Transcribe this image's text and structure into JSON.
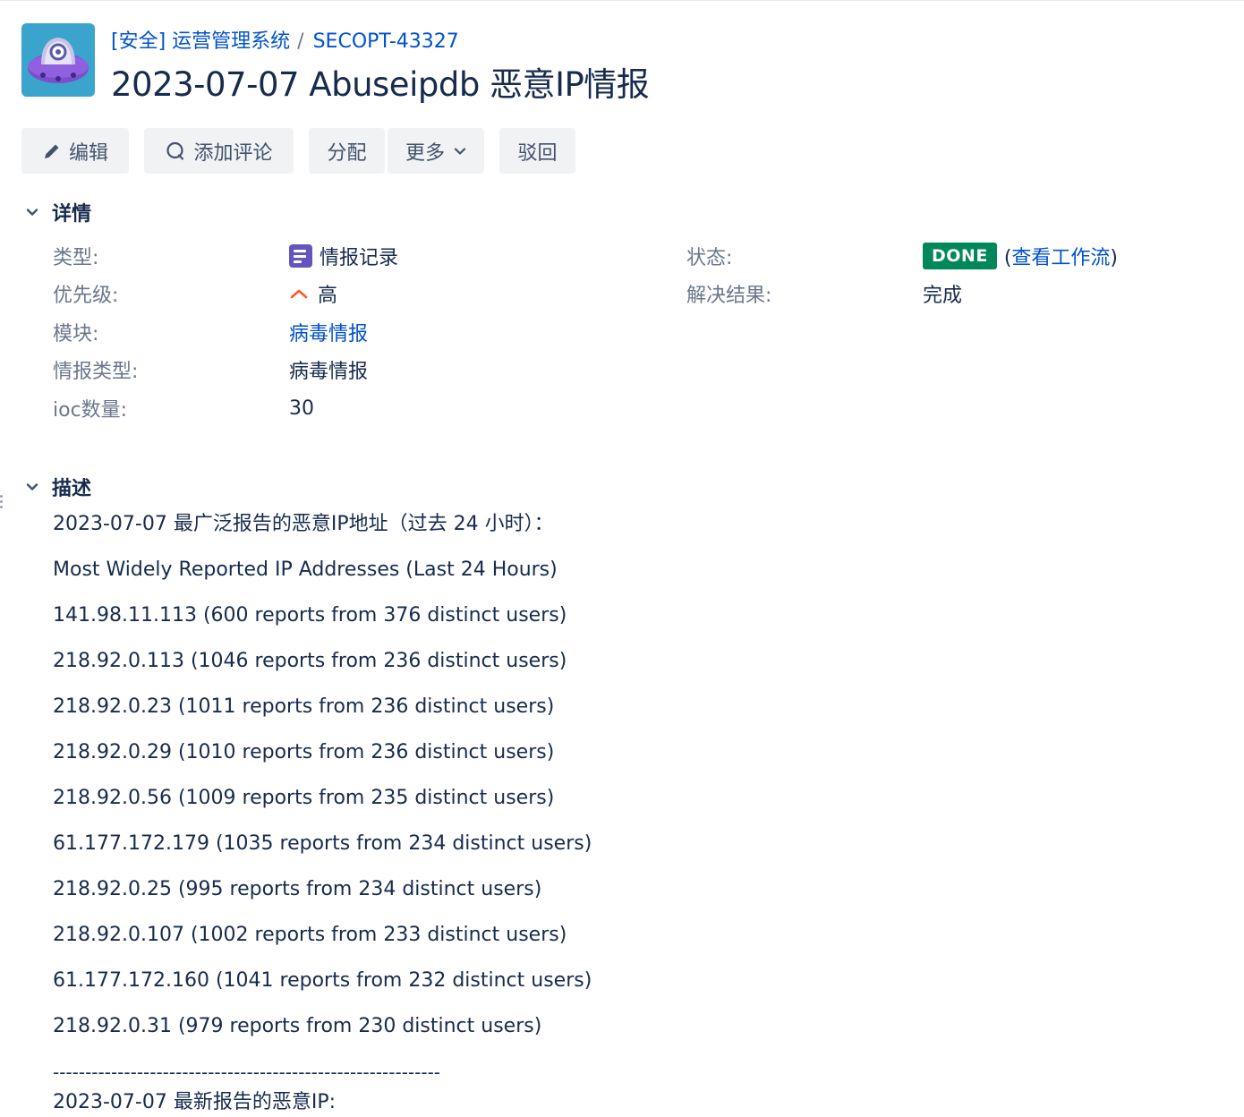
{
  "header": {
    "breadcrumb_project": "[安全] 运营管理系统",
    "breadcrumb_sep": "/",
    "breadcrumb_issue": "SECOPT-43327",
    "title": "2023-07-07 Abuseipdb 恶意IP情报",
    "avatar_icon": "ufo-project-avatar-icon"
  },
  "toolbar": {
    "edit": "编辑",
    "comment": "添加评论",
    "assign": "分配",
    "more": "更多",
    "reject": "驳回"
  },
  "details": {
    "section_title": "详情",
    "type_label": "类型:",
    "type_value": "情报记录",
    "priority_label": "优先级:",
    "priority_value": "高",
    "module_label": "模块:",
    "module_value": "病毒情报",
    "intel_type_label": "情报类型:",
    "intel_type_value": "病毒情报",
    "ioc_label": "ioc数量:",
    "ioc_value": "30",
    "status_label": "状态:",
    "status_value": "DONE",
    "status_color": "#00875a",
    "workflow_open": "(",
    "workflow_link": "查看工作流",
    "workflow_close": ")",
    "resolution_label": "解决结果:",
    "resolution_value": "完成"
  },
  "description": {
    "section_title": "描述",
    "lines": [
      "2023-07-07 最广泛报告的恶意IP地址（过去 24 小时）：",
      "Most Widely Reported IP Addresses (Last 24 Hours)",
      "141.98.11.113 (600 reports from 376 distinct users)",
      "218.92.0.113 (1046 reports from 236 distinct users)",
      "218.92.0.23 (1011 reports from 236 distinct users)",
      "218.92.0.29 (1010 reports from 236 distinct users)",
      "218.92.0.56 (1009 reports from 235 distinct users)",
      "61.177.172.179 (1035 reports from 234 distinct users)",
      "218.92.0.25 (995 reports from 234 distinct users)",
      "218.92.0.107 (1002 reports from 233 distinct users)",
      "61.177.172.160 (1041 reports from 232 distinct users)",
      "218.92.0.31 (979 reports from 230 distinct users)",
      "------------------------------------------------------------",
      "2023-07-07 最新报告的恶意IP:"
    ]
  },
  "colors": {
    "link": "#0052cc",
    "text": "#172b4d",
    "label": "#6b778c",
    "button_bg": "#f1f2f4",
    "type_icon": "#6554c0",
    "priority_high": "#ff5630"
  }
}
